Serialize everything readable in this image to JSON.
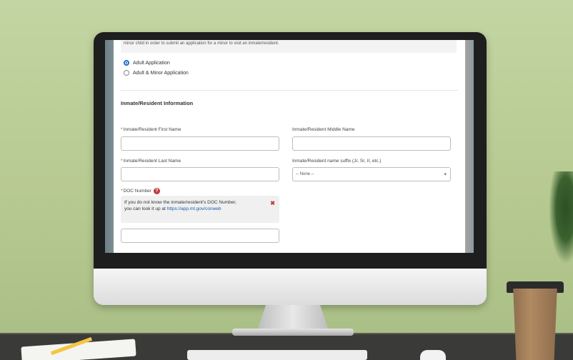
{
  "form": {
    "top_note": "minor child in order to submit an application for a minor to visit an inmate/resident.",
    "application_type": {
      "options": [
        "Adult Application",
        "Adult & Minor Application"
      ],
      "selected": "Adult Application"
    },
    "section_title": "Inmate/Resident Information",
    "fields": {
      "first_name": {
        "label": "Inmate/Resident First Name",
        "required_mark": "*",
        "value": ""
      },
      "middle_name": {
        "label": "Inmate/Resident Middle Name",
        "value": ""
      },
      "last_name": {
        "label": "Inmate/Resident Last Name",
        "required_mark": "*",
        "value": ""
      },
      "suffix": {
        "label": "Inmate/Resident name suffix (Jr, Sr, II, etc.)",
        "selected": "-- None --"
      },
      "doc_number": {
        "label": "DOC Number",
        "required_mark": "*",
        "value": ""
      }
    },
    "help_tooltip": {
      "text_line1": "If you do not know the inmate/resident's DOC Number,",
      "text_line2_prefix": "you can look it up at ",
      "link": "https://app.mt.gov/conweb",
      "close_glyph": "✖"
    }
  },
  "icons": {
    "help": "question-circle-icon",
    "close": "close-icon",
    "dropdown": "chevron-down-icon"
  },
  "colors": {
    "accent": "#1b6fc9",
    "required": "#c23934",
    "link": "#1b5fa8"
  }
}
